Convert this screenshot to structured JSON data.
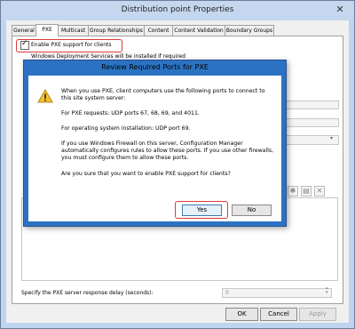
{
  "window": {
    "title": "Distribution point Properties",
    "close_glyph": "✕"
  },
  "tabs": [
    {
      "label": "General"
    },
    {
      "label": "PXE"
    },
    {
      "label": "Multicast"
    },
    {
      "label": "Group Relationships"
    },
    {
      "label": "Content"
    },
    {
      "label": "Content Validation"
    },
    {
      "label": "Boundary Groups"
    }
  ],
  "pxe": {
    "enable_label": "Enable PXE support for clients",
    "enable_checked": true,
    "wds_note": "Windows Deployment Services will be installed if required",
    "delay_label": "Specify the PXE server response delay (seconds):",
    "delay_value": "0"
  },
  "dialog": {
    "title": "Review Required Ports for PXE",
    "para1": "When you use PXE, client computers use the following ports to connect to this site system server:",
    "para2": "For PXE requests: UDP ports 67, 68, 69, and 4011.",
    "para3": "For operating system installation: UDP port 69.",
    "para4": "If you use Windows Firewall on this server, Configuration Manager automatically configures rules to allow these ports. If you use other firewalls, you must configure them to allow these ports.",
    "para5": "Are you sure that you want to enable PXE support for clients?",
    "yes_label": "Yes",
    "no_label": "No"
  },
  "buttons": {
    "ok": "OK",
    "cancel": "Cancel",
    "apply": "Apply"
  },
  "colors": {
    "highlight": "#d93a3a",
    "dialog_frame": "#2b73c2",
    "title_bar": "#c5d7ef"
  }
}
